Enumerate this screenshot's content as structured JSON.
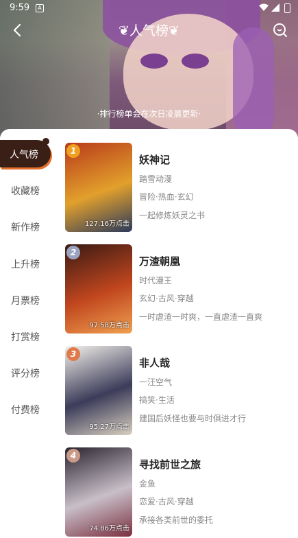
{
  "status_bar": {
    "time": "9:59",
    "notification_glyph": "A"
  },
  "header": {
    "title": "人气榜",
    "notice": "·排行榜单会在次日凌晨更新·"
  },
  "sidebar": {
    "items": [
      {
        "label": "人气榜",
        "active": true
      },
      {
        "label": "收藏榜",
        "active": false
      },
      {
        "label": "新作榜",
        "active": false
      },
      {
        "label": "上升榜",
        "active": false
      },
      {
        "label": "月票榜",
        "active": false
      },
      {
        "label": "打赏榜",
        "active": false
      },
      {
        "label": "评分榜",
        "active": false
      },
      {
        "label": "付费榜",
        "active": false
      }
    ]
  },
  "rankings": [
    {
      "rank": "1",
      "title": "妖神记",
      "author": "踏雪动漫",
      "tags": "冒险·热血·玄幻",
      "desc": "一起修炼妖灵之书",
      "clicks": "127.16万点击",
      "badge_color": "#f0a020",
      "cover_colors": [
        "#b83a1a",
        "#e2a02c",
        "#2c3a5c"
      ]
    },
    {
      "rank": "2",
      "title": "万渣朝凰",
      "author": "时代漫王",
      "tags": "玄幻·古风·穿越",
      "desc": "一时虐渣一时爽，一直虐渣一直爽",
      "clicks": "97.58万点击",
      "badge_color": "#9aa4c0",
      "cover_colors": [
        "#3a1a14",
        "#c0461e",
        "#f0a050"
      ]
    },
    {
      "rank": "3",
      "title": "非人哉",
      "author": "一汪空气",
      "tags": "搞笑·生活",
      "desc": "建国后妖怪也要与时俱进才行",
      "clicks": "95.27万点击",
      "badge_color": "#e07a4a",
      "cover_colors": [
        "#f4f1ea",
        "#3c3c5a",
        "#d9d0c0"
      ]
    },
    {
      "rank": "4",
      "title": "寻找前世之旅",
      "author": "金鱼",
      "tags": "恋爱·古风·穿越",
      "desc": "承接各类前世的委托",
      "clicks": "74.86万点击",
      "badge_color": "#c99a88",
      "cover_colors": [
        "#2a2430",
        "#c8bfc8",
        "#7a3040"
      ]
    }
  ]
}
